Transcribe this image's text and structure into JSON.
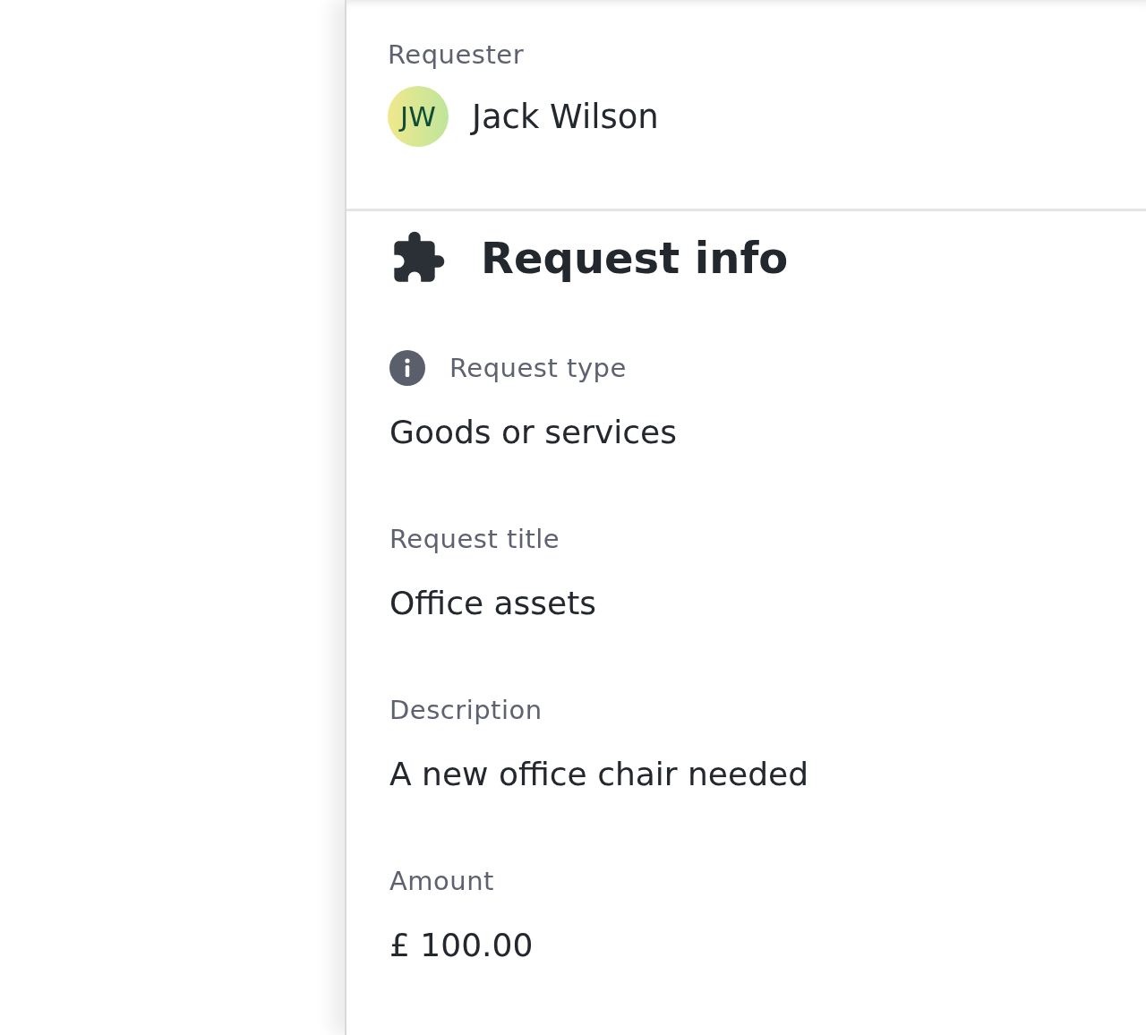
{
  "requester": {
    "label": "Requester",
    "initials": "JW",
    "name": "Jack Wilson"
  },
  "section": {
    "title": "Request info"
  },
  "fields": [
    {
      "kind": "info",
      "label": "Request type",
      "value": "Goods or services"
    },
    {
      "kind": "plain",
      "label": "Request title",
      "value": "Office assets"
    },
    {
      "kind": "plain",
      "label": "Description",
      "value": "A new office chair needed"
    },
    {
      "kind": "plain",
      "label": "Amount",
      "value": "£ 100.00"
    }
  ]
}
